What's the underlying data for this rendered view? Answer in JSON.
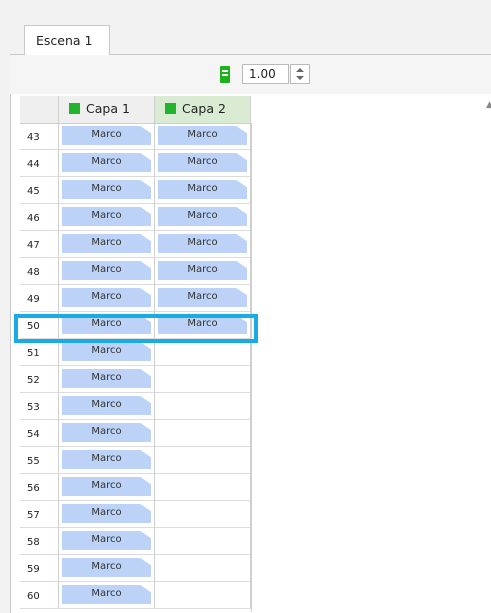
{
  "scene_tab": {
    "label": "Escena 1"
  },
  "toolbar": {
    "fps_value": "1.00",
    "fps_icon": "film-frames-icon"
  },
  "columns": [
    {
      "label": "Capa 1",
      "color": "#21b32b"
    },
    {
      "label": "Capa 2",
      "color": "#21b32b"
    }
  ],
  "rows": [
    {
      "num": "43",
      "c1": "Marco",
      "c2": "Marco"
    },
    {
      "num": "44",
      "c1": "Marco",
      "c2": "Marco"
    },
    {
      "num": "45",
      "c1": "Marco",
      "c2": "Marco"
    },
    {
      "num": "46",
      "c1": "Marco",
      "c2": "Marco"
    },
    {
      "num": "47",
      "c1": "Marco",
      "c2": "Marco"
    },
    {
      "num": "48",
      "c1": "Marco",
      "c2": "Marco"
    },
    {
      "num": "49",
      "c1": "Marco",
      "c2": "Marco"
    },
    {
      "num": "50",
      "c1": "Marco",
      "c2": "Marco"
    },
    {
      "num": "51",
      "c1": "Marco",
      "c2": ""
    },
    {
      "num": "52",
      "c1": "Marco",
      "c2": ""
    },
    {
      "num": "53",
      "c1": "Marco",
      "c2": ""
    },
    {
      "num": "54",
      "c1": "Marco",
      "c2": ""
    },
    {
      "num": "55",
      "c1": "Marco",
      "c2": ""
    },
    {
      "num": "56",
      "c1": "Marco",
      "c2": ""
    },
    {
      "num": "57",
      "c1": "Marco",
      "c2": ""
    },
    {
      "num": "58",
      "c1": "Marco",
      "c2": ""
    },
    {
      "num": "59",
      "c1": "Marco",
      "c2": ""
    },
    {
      "num": "60",
      "c1": "Marco",
      "c2": ""
    }
  ],
  "highlighted_row": "50",
  "colors": {
    "frame": "#bcd3f7",
    "highlight": "#19abe6",
    "layer2_header": "#d9ecd3"
  }
}
